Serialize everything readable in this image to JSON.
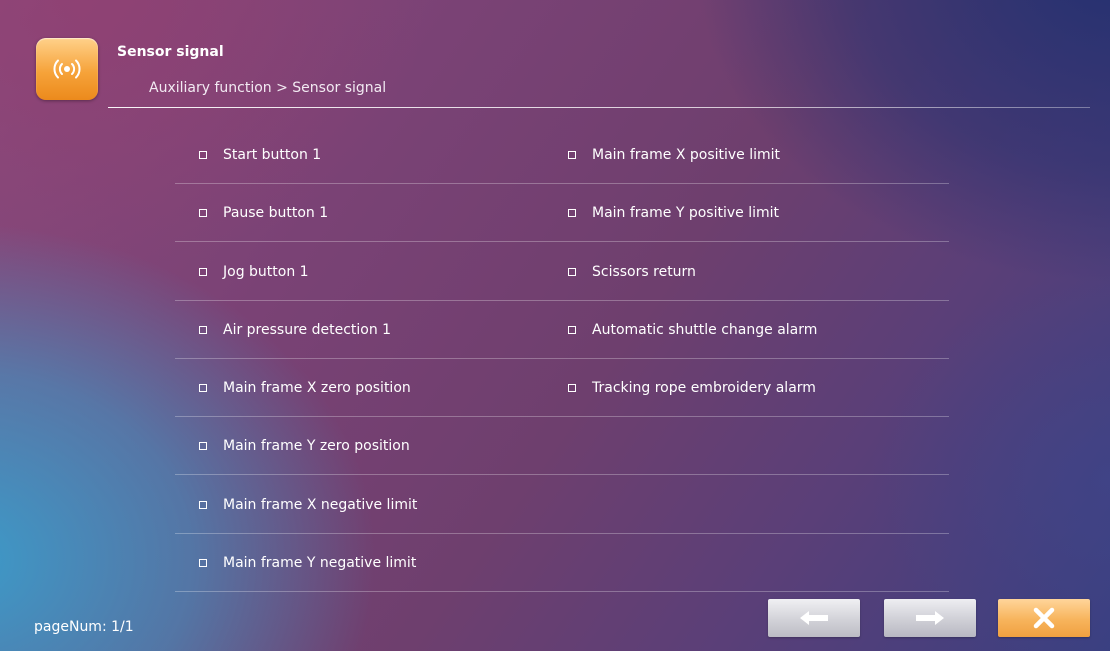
{
  "header": {
    "icon": "sensor-signal-icon",
    "title": "Sensor signal",
    "breadcrumb": "Auxiliary function > Sensor signal"
  },
  "signals": {
    "left": [
      "Start button 1",
      "Pause button 1",
      "Jog button 1",
      "Air pressure detection 1",
      "Main frame X zero position",
      "Main frame Y zero position",
      "Main frame X negative limit",
      "Main frame Y negative limit"
    ],
    "right": [
      "Main frame X positive limit",
      "Main frame Y positive limit",
      "Scissors return",
      "Automatic shuttle change alarm",
      "Tracking rope embroidery alarm"
    ]
  },
  "footer": {
    "page_num": "pageNum: 1/1",
    "prev_icon": "arrow-left-icon",
    "next_icon": "arrow-right-icon",
    "close_icon": "close-icon"
  },
  "colors": {
    "accent_orange": "#f6a33a",
    "button_gray": "#d2d2d8",
    "text": "#ffffff"
  }
}
